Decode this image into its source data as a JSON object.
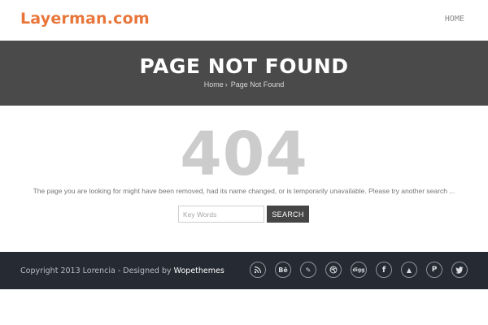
{
  "header": {
    "logo": "Layerman.com",
    "nav": {
      "home": "HOME"
    }
  },
  "banner": {
    "title": "PAGE NOT FOUND",
    "breadcrumb": {
      "home": "Home",
      "separator": "›",
      "current": "Page Not Found"
    }
  },
  "main": {
    "code": "404",
    "message": "The page you are looking for might have been removed, had its name changed, or is temporarily unavailable. Please try another search ...",
    "search": {
      "placeholder": "Key Words",
      "value": "",
      "button": "SEARCH"
    }
  },
  "footer": {
    "copyright_prefix": "Copyright 2013 Lorencia - Designed by ",
    "designer": "Wopethemes",
    "social": [
      {
        "icon": "rss-icon",
        "glyph": ""
      },
      {
        "icon": "behance-icon",
        "glyph": "Bē"
      },
      {
        "icon": "deviantart-icon",
        "glyph": "✎"
      },
      {
        "icon": "dribbble-icon",
        "glyph": ""
      },
      {
        "icon": "digg-icon",
        "glyph": "digg"
      },
      {
        "icon": "facebook-icon",
        "glyph": "f"
      },
      {
        "icon": "forrst-icon",
        "glyph": "▲"
      },
      {
        "icon": "pinterest-icon",
        "glyph": "P"
      },
      {
        "icon": "twitter-icon",
        "glyph": ""
      }
    ]
  },
  "colors": {
    "logo": "#e8763a",
    "banner_bg": "#4a4a4a",
    "footer_bg": "#252a33",
    "code_404": "#cccccc",
    "search_button_bg": "#454545"
  }
}
